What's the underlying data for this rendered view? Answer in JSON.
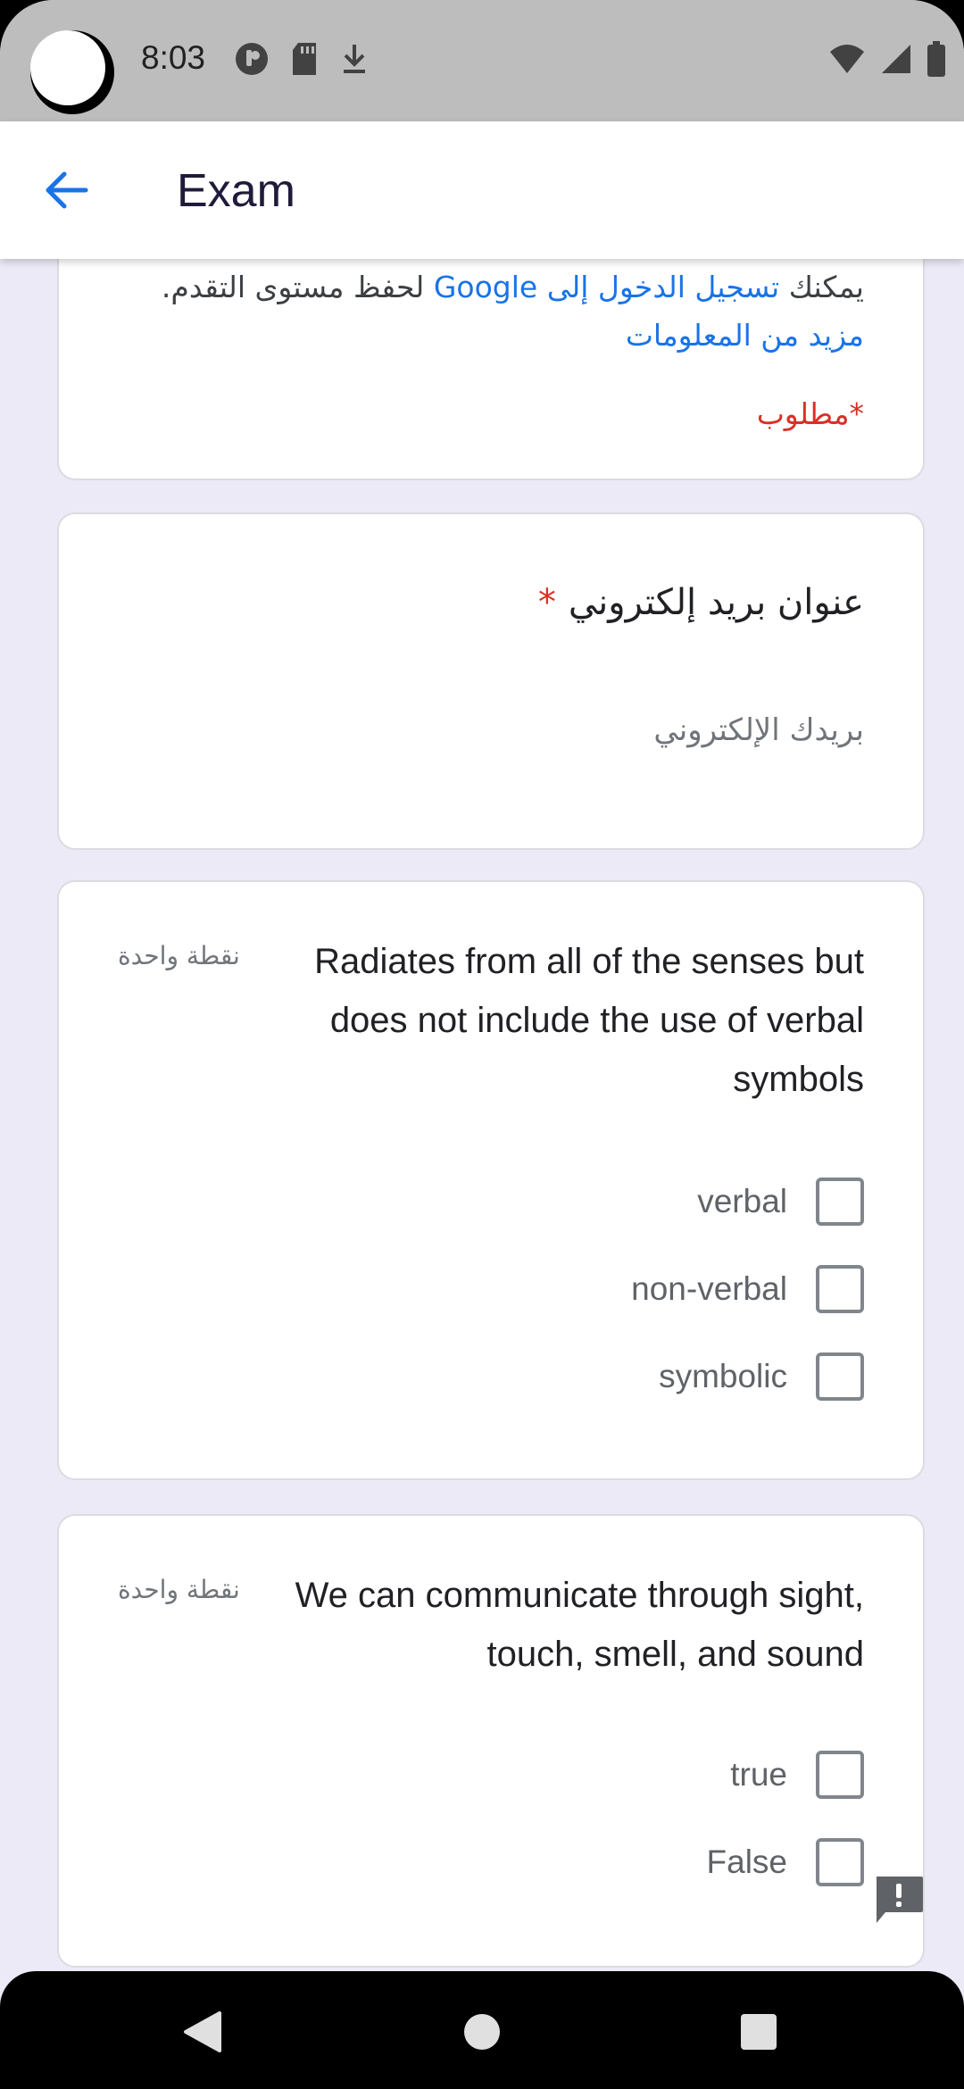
{
  "status_bar": {
    "time": "8:03"
  },
  "app_bar": {
    "title": "Exam"
  },
  "intro": {
    "text_before": "يمكنك ",
    "signin_link": "تسجيل الدخول إلى Google",
    "text_after": " لحفظ مستوى التقدم.",
    "more_info_link": "مزيد من المعلومات",
    "required_note": "*مطلوب"
  },
  "email": {
    "label": "عنوان بريد إلكتروني",
    "required_mark": "*",
    "placeholder": "بريدك الإلكتروني"
  },
  "questions": [
    {
      "text": "Radiates from all of the senses but does not include the use of verbal symbols",
      "points": "نقطة واحدة",
      "options": [
        "verbal",
        "non-verbal",
        "symbolic"
      ]
    },
    {
      "text": "We can communicate through sight, touch, smell, and sound",
      "points": "نقطة واحدة",
      "options": [
        "true",
        "False"
      ]
    }
  ],
  "colors": {
    "accent": "#1A73E8",
    "required": "#D93025",
    "page_background": "#EDEAF7",
    "status_bar": "#BDBDBD"
  },
  "icons": {
    "back": "arrow-left-icon",
    "feedback": "feedback-icon",
    "nav_back": "triangle-back-icon",
    "nav_home": "circle-home-icon",
    "nav_recents": "square-recents-icon"
  }
}
